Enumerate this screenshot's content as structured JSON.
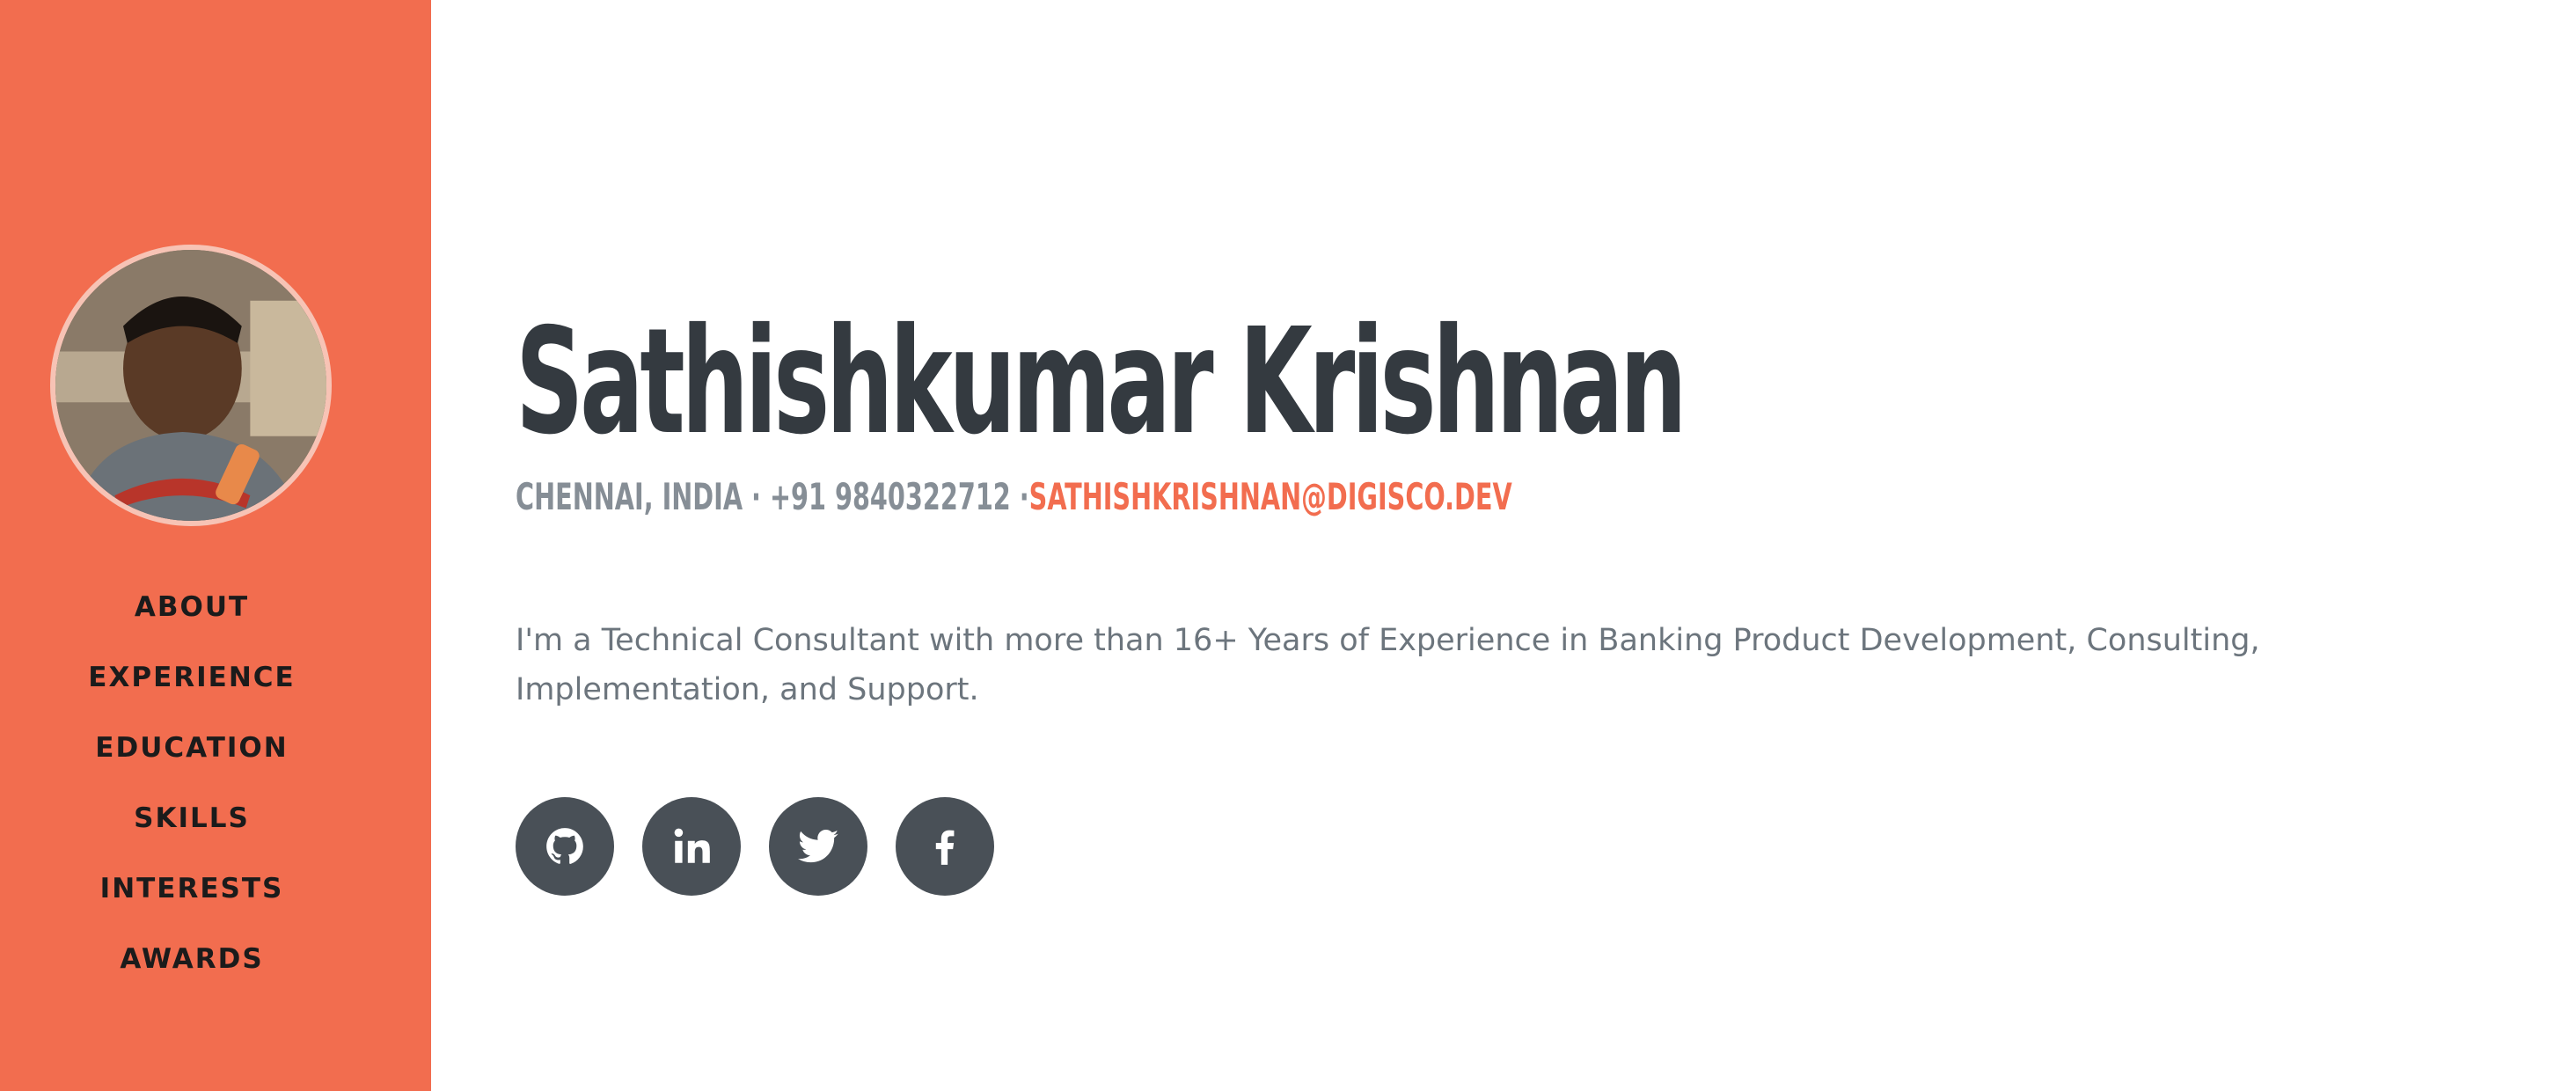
{
  "profile": {
    "name": "Sathishkumar Krishnan",
    "location": "Chennai, India · +91 9840322712 ·",
    "email": "sathishkrishnan@digisco.dev",
    "description": "I'm a Technical Consultant with more than 16+ Years of Experience in Banking Product Development, Consulting, Implementation, and Support."
  },
  "nav": {
    "items": [
      {
        "label": "ABOUT"
      },
      {
        "label": "EXPERIENCE"
      },
      {
        "label": "EDUCATION"
      },
      {
        "label": "SKILLS"
      },
      {
        "label": "INTERESTS"
      },
      {
        "label": "AWARDS"
      }
    ]
  },
  "social": [
    {
      "icon": "github-icon"
    },
    {
      "icon": "linkedin-icon"
    },
    {
      "icon": "twitter-icon"
    },
    {
      "icon": "facebook-icon"
    }
  ],
  "colors": {
    "accent": "#f26d4f",
    "heading": "#343a40",
    "muted": "#868e96",
    "social_bg": "#495057"
  }
}
